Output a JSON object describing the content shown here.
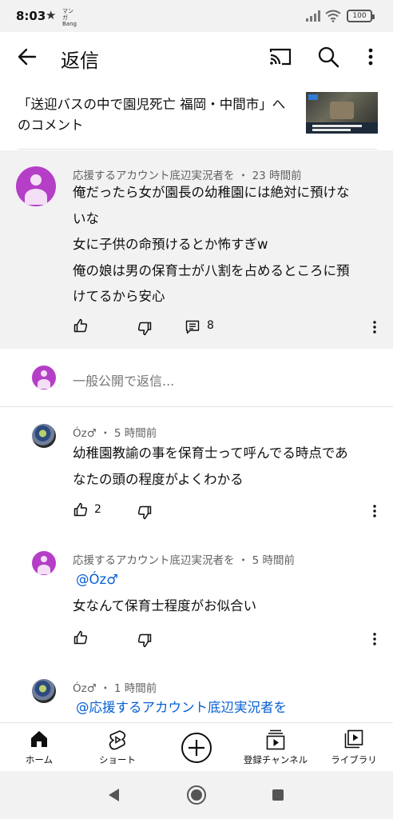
{
  "status_bar": {
    "time": "8:03",
    "app_tag": "マンガ Bang",
    "battery": "100"
  },
  "app_bar": {
    "title": "返信"
  },
  "video": {
    "title": "「送迎バスの中で園児死亡 福岡・中間市」へのコメント"
  },
  "parent_comment": {
    "author": "応援するアカウント底辺実況者を",
    "time": "23 時間前",
    "lines": [
      "俺だったら女が園長の幼稚園には絶対に預けな",
      "いな",
      "女に子供の命預けるとか怖すぎw",
      "俺の娘は男の保育士が八割を占めるところに預",
      "けてるから安心"
    ],
    "reply_count": "8"
  },
  "reply_input": {
    "placeholder": "一般公開で返信..."
  },
  "replies": [
    {
      "author": "Óz♂",
      "time": "5 時間前",
      "lines": [
        "幼稚園教諭の事を保育士って呼んでる時点であ",
        "なたの頭の程度がよくわかる"
      ],
      "likes": "2"
    },
    {
      "author": "応援するアカウント底辺実況者を",
      "time": "5 時間前",
      "mention": "@Óz♂",
      "lines": [
        "女なんて保育士程度がお似合い"
      ],
      "likes": ""
    },
    {
      "author": "Óz♂",
      "time": "1 時間前",
      "mention": "@応援するアカウント底辺実況者を",
      "lines": [],
      "likes": ""
    }
  ],
  "bottom_nav": [
    {
      "label": "ホーム",
      "icon": "home-icon"
    },
    {
      "label": "ショート",
      "icon": "shorts-icon"
    },
    {
      "label": "",
      "icon": "create-icon"
    },
    {
      "label": "登録チャンネル",
      "icon": "subscriptions-icon"
    },
    {
      "label": "ライブラリ",
      "icon": "library-icon"
    }
  ],
  "colors": {
    "mention": "#065fd4",
    "avatar_purple": "#b53ec7",
    "thread_bg": "#f2f2f2"
  }
}
